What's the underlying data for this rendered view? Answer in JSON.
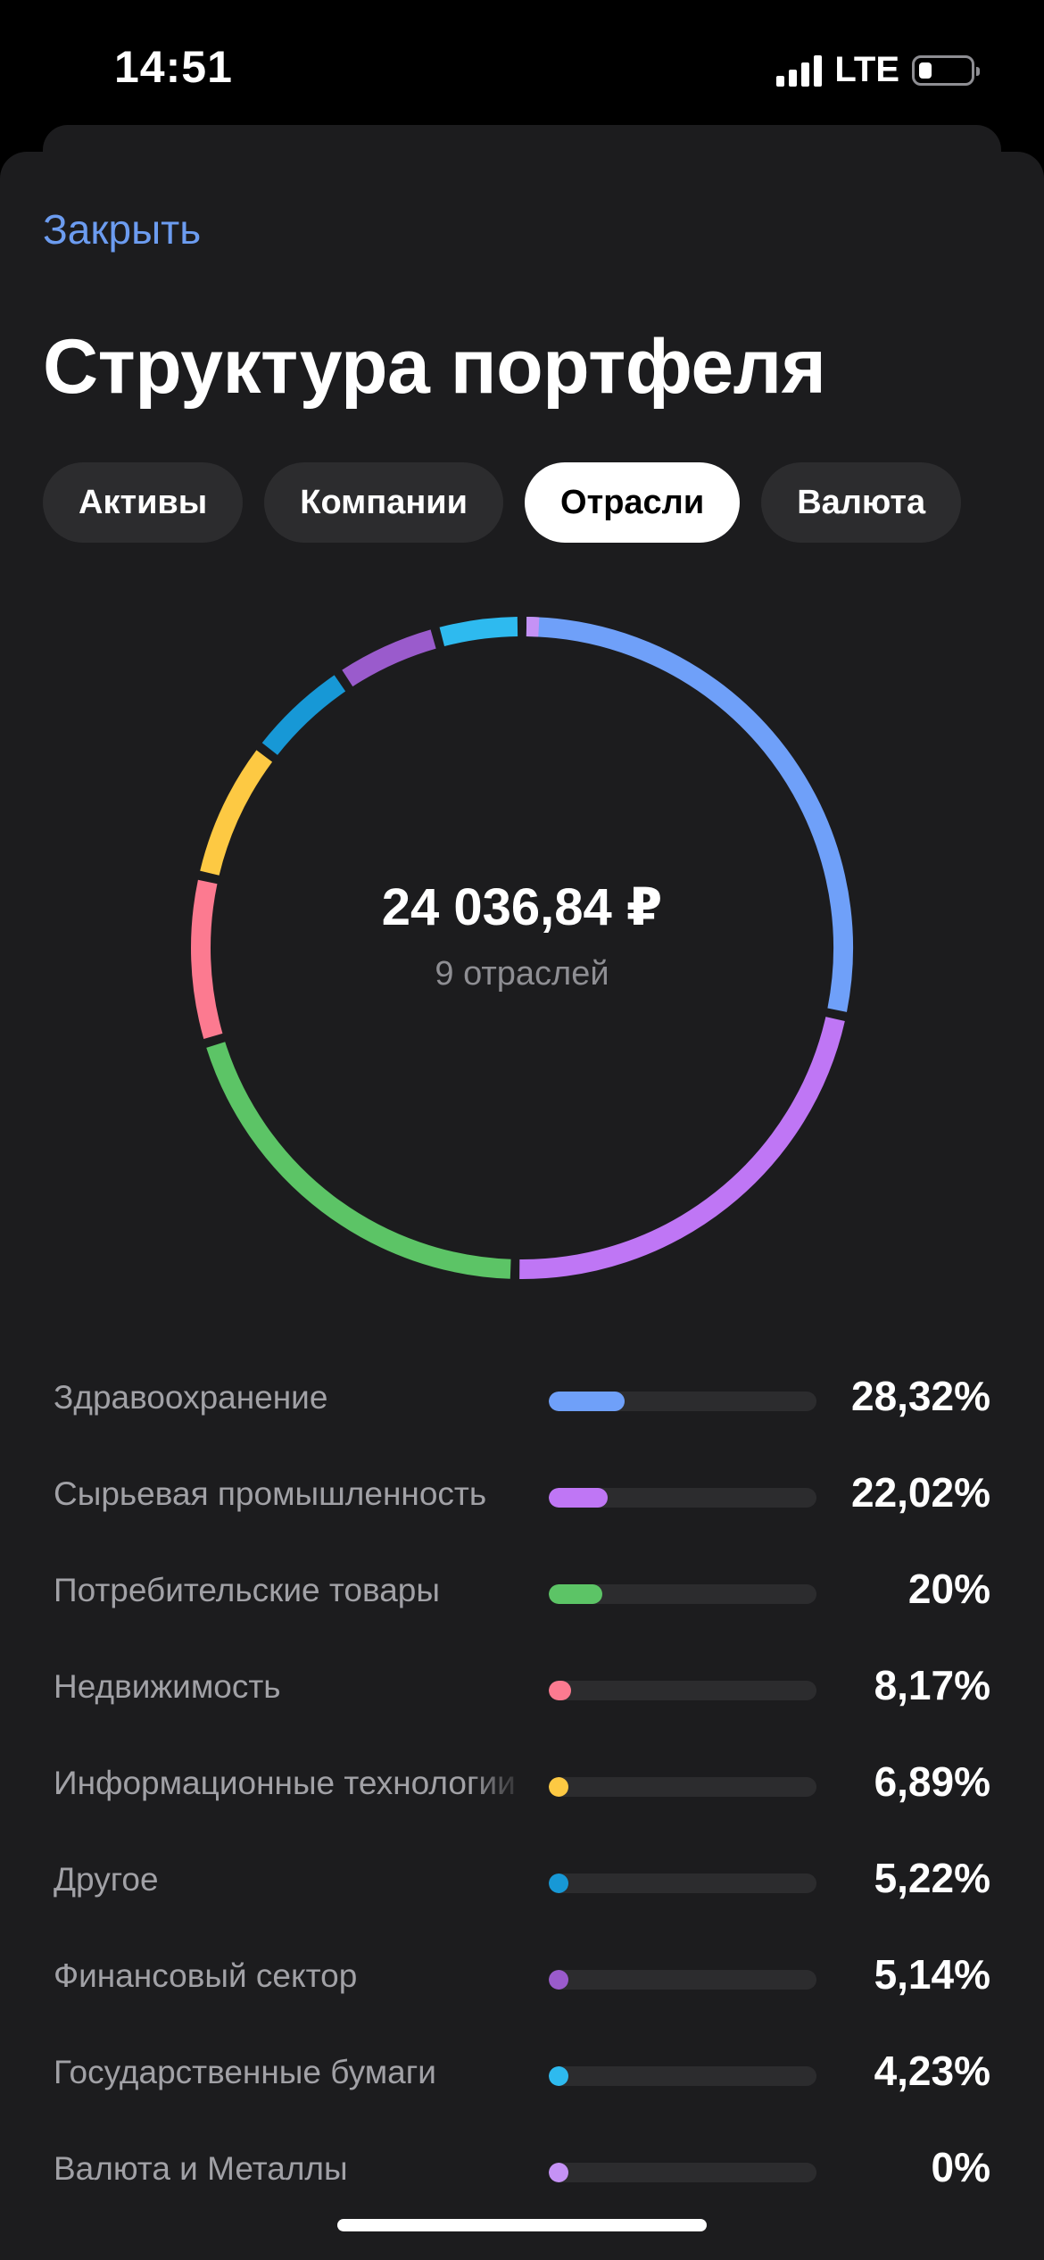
{
  "status_bar": {
    "time": "14:51",
    "network": "LTE"
  },
  "header": {
    "close_label": "Закрыть",
    "title": "Структура портфеля"
  },
  "tabs": [
    {
      "label": "Активы",
      "active": false
    },
    {
      "label": "Компании",
      "active": false
    },
    {
      "label": "Отрасли",
      "active": true
    },
    {
      "label": "Валюта",
      "active": false
    }
  ],
  "summary": {
    "total": "24 036,84 ₽",
    "subtitle": "9 отраслей"
  },
  "chart_data": {
    "type": "pie",
    "categories": [
      "Здравоохранение",
      "Сырьевая промышленность",
      "Потребительские товары",
      "Недвижимость",
      "Информационные технологии",
      "Другое",
      "Финансовый сектор",
      "Государственные бумаги",
      "Валюта и Металлы"
    ],
    "values": [
      28.32,
      22.02,
      20,
      8.17,
      6.89,
      5.22,
      5.14,
      4.23,
      0
    ],
    "colors": [
      "#6fa0f9",
      "#bf76f5",
      "#5cc466",
      "#fc7a90",
      "#fdc943",
      "#1798d6",
      "#9a5bcc",
      "#2ebaef",
      "#c592f5"
    ]
  },
  "legend": [
    {
      "label": "Здравоохранение",
      "value": "28,32%",
      "percent": 28.32,
      "color": "#6fa0f9"
    },
    {
      "label": "Сырьевая промышленность",
      "value": "22,02%",
      "percent": 22.02,
      "color": "#bf76f5"
    },
    {
      "label": "Потребительские товары",
      "value": "20%",
      "percent": 20,
      "color": "#5cc466"
    },
    {
      "label": "Недвижимость",
      "value": "8,17%",
      "percent": 8.17,
      "color": "#fc7a90"
    },
    {
      "label": "Информационные технологии",
      "value": "6,89%",
      "percent": 6.89,
      "color": "#fdc943"
    },
    {
      "label": "Другое",
      "value": "5,22%",
      "percent": 5.22,
      "color": "#1798d6"
    },
    {
      "label": "Финансовый сектор",
      "value": "5,14%",
      "percent": 5.14,
      "color": "#9a5bcc"
    },
    {
      "label": "Государственные бумаги",
      "value": "4,23%",
      "percent": 4.23,
      "color": "#2ebaef"
    },
    {
      "label": "Валюта и Металлы",
      "value": "0%",
      "percent": 0,
      "color": "#c592f5"
    }
  ]
}
